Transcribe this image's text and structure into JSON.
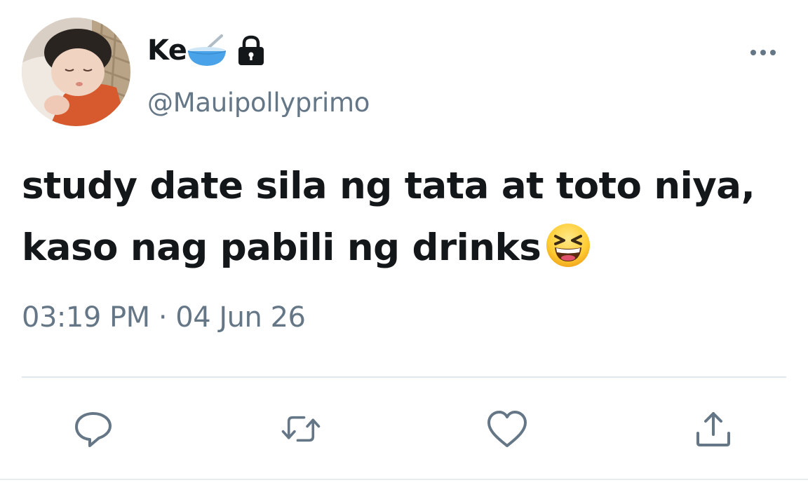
{
  "user": {
    "display_name": "Ke",
    "handle": "@Mauipollyprimo",
    "name_emoji_icon": "bowl-with-spoon-icon",
    "protected_icon": "lock-icon"
  },
  "tweet": {
    "text_line_1": "study date sila ng tata at toto niya,",
    "text_line_2": "kaso nag pabili ng drinks",
    "emoji_icon": "grinning-squinting-face-icon",
    "timestamp": "03:19 PM · 04 Jun 26"
  },
  "actions": [
    {
      "name": "reply",
      "icon": "reply-icon"
    },
    {
      "name": "retweet",
      "icon": "retweet-icon"
    },
    {
      "name": "like",
      "icon": "heart-icon"
    },
    {
      "name": "share",
      "icon": "share-icon"
    }
  ],
  "colors": {
    "text_primary": "#14171a",
    "text_secondary": "#657786",
    "icon_gray": "#657786",
    "divider": "#e1e8ed"
  }
}
